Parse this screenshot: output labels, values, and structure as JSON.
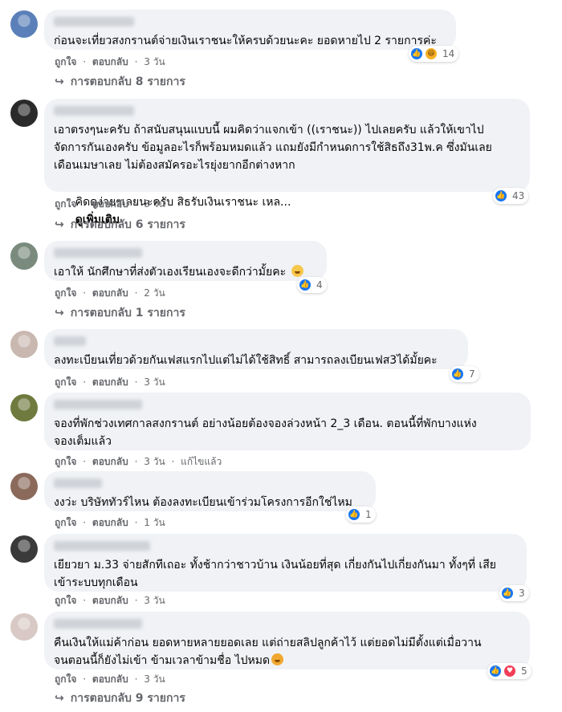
{
  "comments": [
    {
      "text": "ก่อนจะเที่ยวสงกรานต์จ่ายเงินเราชนะให้ครบด้วยนะคะ ยอดหายไป 2 รายการค่ะ",
      "reaction_count": "14",
      "reactions": [
        "like-icon",
        "haha-icon"
      ],
      "like": "ถูกใจ",
      "reply": "ตอบกลับ",
      "time": "3 วัน",
      "replies": "การตอบกลับ 8 รายการ"
    },
    {
      "text": "เอาตรงๆนะครับ ถ้าสนับสนุนแบบนี้ ผมคิดว่าแจกเข้า ((เราชนะ)) ไปเลยครับ แล้วให้เขาไป\nจัดการกันเองครับ ข้อมูลอะไรก็พร้อมหมดแล้ว แถมยังมีกำหนดการใช้สิธถึง31พ.ค ซึ่งมันเลย\nเดือนเมษาเลย ไม่ต้องสมัครอะไรยุ่งยากอีกต่างหาก",
      "text2": "คิดดูง่ายๆเลยนะครับ สิธรับเงินเราชนะ เหล...",
      "see_more": "ดูเพิ่มเติม",
      "reaction_count": "43",
      "reactions": [
        "like-icon"
      ],
      "like": "ถูกใจ",
      "reply": "ตอบกลับ",
      "time": "3 วัน",
      "replies": "การตอบกลับ 6 รายการ"
    },
    {
      "text": "เอาให้ นักศึกษาที่ส่งตัวเองเรียนเองจะดีกว่ามั้ยคะ",
      "reaction_count": "4",
      "reactions": [
        "like-icon"
      ],
      "like": "ถูกใจ",
      "reply": "ตอบกลับ",
      "time": "2 วัน",
      "replies": "การตอบกลับ 1 รายการ"
    },
    {
      "text": "ลงทะเบียนเที่ยวด้วยกันเฟสแรกไปแต่ไม่ได้ใช้สิทธิ์ สามารถลงเบียนเฟส3ได้มั้ยคะ",
      "reaction_count": "7",
      "reactions": [
        "like-icon"
      ],
      "like": "ถูกใจ",
      "reply": "ตอบกลับ",
      "time": "3 วัน"
    },
    {
      "text": "จองที่พักช่วงเทศกาลสงกรานต์ อย่างน้อยต้องจองล่วงหน้า 2_3 เดือน. ตอนนี้ที่พักบางแห่ง\nจองเต็มแล้ว",
      "like": "ถูกใจ",
      "reply": "ตอบกลับ",
      "time": "3 วัน",
      "edited": "แก้ไขแล้ว"
    },
    {
      "text": "งงว่ะ บริษัททัวร์ไหน ต้องลงทะเบียนเข้าร่วมโครงการอีกใช่ไหม",
      "reaction_count": "1",
      "reactions": [
        "like-icon"
      ],
      "like": "ถูกใจ",
      "reply": "ตอบกลับ",
      "time": "1 วัน"
    },
    {
      "text": "เยียวยา ม.33 จ่ายสักทีเถอะ ทั้งช้ากว่าชาวบ้าน เงินน้อยที่สุด เกี่ยงกันไปเกี่ยงกันมา ทั้งๆที่ เสีย\nเข้าระบบทุกเดือน",
      "reaction_count": "3",
      "reactions": [
        "like-icon"
      ],
      "like": "ถูกใจ",
      "reply": "ตอบกลับ",
      "time": "3 วัน"
    },
    {
      "text": "คืนเงินให้แม่ค้าก่อน ยอดหายหลายยอดเลย แต่ถ่ายสลิปลูกค้าไว้ แต่ยอดไม่มีตั้งแต่เมื่อวาน\nจนตอนนี้ก็ยังไม่เข้า ข้ามเวลาข้ามชื่อ ไปหมด",
      "reaction_count": "5",
      "reactions": [
        "like-icon",
        "love-icon"
      ],
      "like": "ถูกใจ",
      "reply": "ตอบกลับ",
      "time": "3 วัน",
      "replies": "การตอบกลับ 9 รายการ"
    }
  ],
  "separator": "·"
}
